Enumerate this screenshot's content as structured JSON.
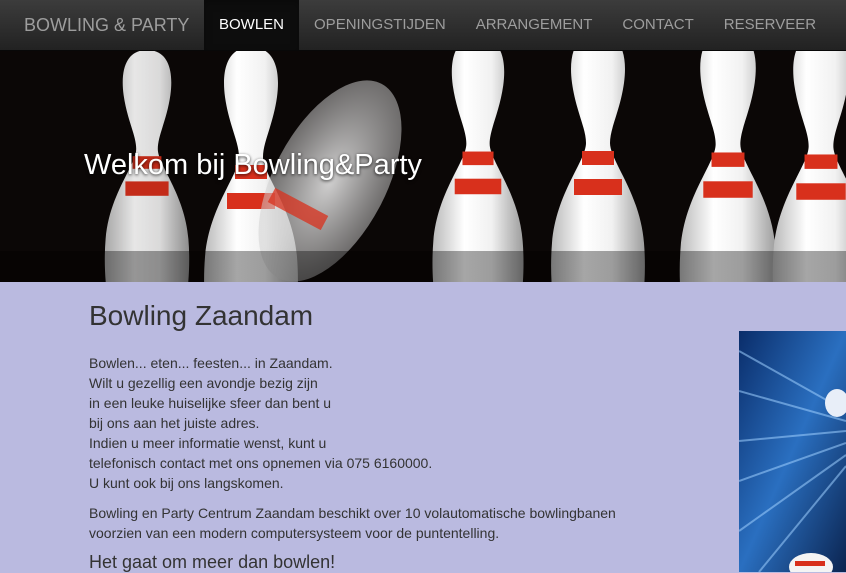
{
  "nav": {
    "brand": "BOWLING & PARTY",
    "items": [
      {
        "label": "BOWLEN",
        "active": true
      },
      {
        "label": "OPENINGSTIJDEN",
        "active": false
      },
      {
        "label": "ARRANGEMENT",
        "active": false
      },
      {
        "label": "CONTACT",
        "active": false
      },
      {
        "label": "RESERVEER",
        "active": false
      }
    ]
  },
  "hero": {
    "title": "Welkom bij Bowling&Party"
  },
  "main": {
    "heading": "Bowling Zaandam",
    "intro_lines": [
      "Bowlen... eten... feesten... in Zaandam.",
      "Wilt u gezellig een avondje bezig zijn",
      "in een leuke huiselijke sfeer dan bent u",
      "bij ons aan het juiste adres.",
      "Indien u meer informatie wenst, kunt u",
      "telefonisch contact met ons opnemen via 075 6160000.",
      "U kunt ook bij ons langskomen."
    ],
    "paragraph": "Bowling en Party Centrum Zaandam beschikt over 10 volautomatische bowlingbanen voorzien van een modern computersysteem voor de puntentelling.",
    "subheading": "Het gaat om meer dan bowlen!"
  },
  "colors": {
    "navbar": "#222222",
    "active_tab": "#0d0d0d",
    "page_background": "#babae0",
    "pin_stripe": "#d8301c"
  }
}
